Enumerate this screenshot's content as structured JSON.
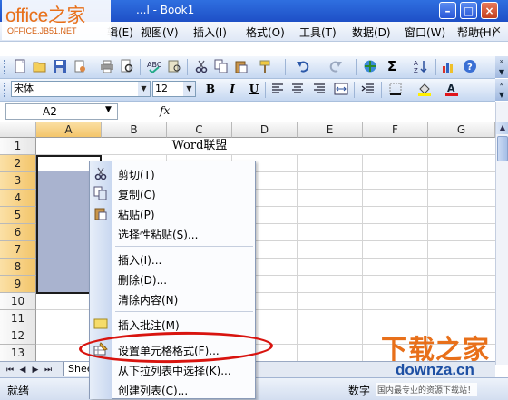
{
  "window": {
    "title": "Microsoft Excel - Book1",
    "title_visible": "...l - Book1"
  },
  "logo": {
    "main": "office之家",
    "sub": "OFFICE.JB51.NET"
  },
  "menubar": {
    "items": [
      "视图(V)",
      "插入(I)",
      "格式(O)",
      "工具(T)",
      "数据(D)",
      "窗口(W)",
      "帮助(H)"
    ],
    "partial_item": "辑(E)"
  },
  "format_toolbar": {
    "font_name": "宋体",
    "font_size": "12"
  },
  "formula_bar": {
    "name_box": "A2",
    "fx": "fx",
    "content": ""
  },
  "sheet": {
    "columns": [
      "A",
      "B",
      "C",
      "D",
      "E",
      "F",
      "G"
    ],
    "rows": [
      "1",
      "2",
      "3",
      "4",
      "5",
      "6",
      "7",
      "8",
      "9",
      "10",
      "11",
      "12",
      "13"
    ],
    "c1_text": "Word联盟",
    "selected_range": "A2:A9",
    "tab_label": "Shee"
  },
  "context_menu": {
    "items": [
      {
        "label": "剪切(T)",
        "icon": "scissors-icon"
      },
      {
        "label": "复制(C)",
        "icon": "copy-icon"
      },
      {
        "label": "粘贴(P)",
        "icon": "paste-icon"
      },
      {
        "label": "选择性粘贴(S)...",
        "icon": ""
      },
      {
        "label": "插入(I)...",
        "icon": ""
      },
      {
        "label": "删除(D)...",
        "icon": ""
      },
      {
        "label": "清除内容(N)",
        "icon": ""
      },
      {
        "label": "插入批注(M)",
        "icon": "comment-icon"
      },
      {
        "label": "设置单元格格式(F)...",
        "icon": "format-cells-icon"
      },
      {
        "label": "从下拉列表中选择(K)...",
        "icon": ""
      },
      {
        "label": "创建列表(C)...",
        "icon": ""
      }
    ]
  },
  "status_bar": {
    "left": "就绪",
    "right": "数字"
  },
  "watermark": {
    "big": "下载之家",
    "url": "downza.cn",
    "slogan": "国内最专业的资源下载站！"
  },
  "colors": {
    "title_bar": "#1e4fc6",
    "selection": "#a9b3cf",
    "highlight_ring": "#d8140f",
    "watermark_orange": "#e8701a",
    "watermark_blue": "#1d4fa3"
  }
}
